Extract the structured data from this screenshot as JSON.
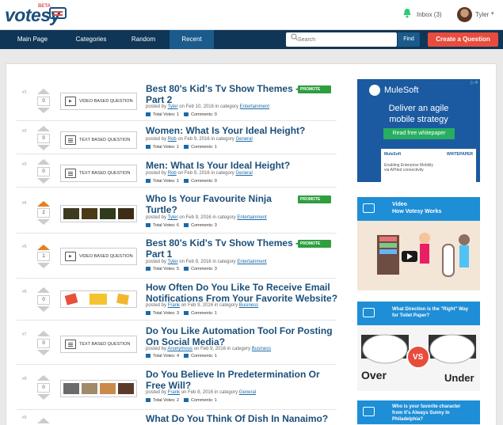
{
  "brand": {
    "name": "votesy",
    "badge": "BETA"
  },
  "header": {
    "inbox_label": "Inbox (3)",
    "user_name": "Tyler"
  },
  "nav": {
    "items": [
      {
        "label": "Main Page"
      },
      {
        "label": "Categories"
      },
      {
        "label": "Random"
      },
      {
        "label": "Recent",
        "active": true
      }
    ],
    "search_placeholder": "Search",
    "find_label": "Find",
    "create_label": "Create a Question"
  },
  "questions": [
    {
      "num": "#1",
      "votes": "0",
      "thumb_type": "video",
      "thumb_label": "VIDEO BASED QUESTION",
      "title_l1": "Best 80's Kid's Tv Show Themes -",
      "title_l2": "Part 2",
      "promote": "PROMOTE",
      "posted_by": "posted by",
      "author": "Tyler",
      "date_text": "on Feb 10, 2016 in category",
      "category": "Entertainment",
      "total_votes": "Total Votes: 1",
      "comments": "Comments: 0"
    },
    {
      "num": "#2",
      "votes": "0",
      "thumb_type": "text",
      "thumb_label": "TEXT BASED QUESTION",
      "title_l1": "Women: What Is Your Ideal Height?",
      "posted_by": "posted by",
      "author": "Rob",
      "date_text": "on Feb 9, 2016 in category",
      "category": "General",
      "total_votes": "Total Votes: 1",
      "comments": "Comments: 1"
    },
    {
      "num": "#3",
      "votes": "0",
      "thumb_type": "text",
      "thumb_label": "TEXT BASED QUESTION",
      "title_l1": "Men: What Is Your Ideal Height?",
      "posted_by": "posted by",
      "author": "Rob",
      "date_text": "on Feb 9, 2016 in category",
      "category": "General",
      "total_votes": "Total Votes: 1",
      "comments": "Comments: 0"
    },
    {
      "num": "#4",
      "votes": "2",
      "thumb_type": "images",
      "title_l1": "Who Is Your Favourite Ninja",
      "title_l2": "Turtle?",
      "promote": "PROMOTE",
      "posted_by": "posted by",
      "author": "Tyler",
      "date_text": "on Feb 9, 2016 in category",
      "category": "Entertainment",
      "total_votes": "Total Votes: 6",
      "comments": "Comments: 3",
      "voted": true
    },
    {
      "num": "#5",
      "votes": "1",
      "thumb_type": "video",
      "thumb_label": "VIDEO BASED QUESTION",
      "title_l1": "Best 80's Kid's Tv Show Themes -",
      "title_l2": "Part 1",
      "promote": "PROMOTE",
      "posted_by": "posted by",
      "author": "Tyler",
      "date_text": "on Feb 9, 2016 in category",
      "category": "Entertainment",
      "total_votes": "Total Votes: 5",
      "comments": "Comments: 3",
      "voted": true
    },
    {
      "num": "#6",
      "votes": "0",
      "thumb_type": "images2",
      "title_l1": "How Often Do You Like To Receive Email",
      "title_l2": "Notifications From Your Favorite Website?",
      "posted_by": "posted by",
      "author": "Frank",
      "date_text": "on Feb 9, 2016 in category",
      "category": "Business",
      "total_votes": "Total Votes: 3",
      "comments": "Comments: 1"
    },
    {
      "num": "#7",
      "votes": "0",
      "thumb_type": "text",
      "thumb_label": "TEXT BASED QUESTION",
      "title_l1": "Do You Like Automation Tool For Posting",
      "title_l2": "On Social Media?",
      "posted_by": "posted by",
      "author": "Anonymous",
      "date_text": "on Feb 9, 2016 in category",
      "category": "Business",
      "total_votes": "Total Votes: 4",
      "comments": "Comments: 1"
    },
    {
      "num": "#8",
      "votes": "0",
      "thumb_type": "images3",
      "title_l1": "Do You Believe In Predetermination Or",
      "title_l2": "Free Will?",
      "posted_by": "posted by",
      "author": "Frank",
      "date_text": "on Feb 8, 2016 in category",
      "category": "General",
      "total_votes": "Total Votes: 2",
      "comments": "Comments: 1"
    },
    {
      "num": "#9",
      "title_l1": "What Do You Think Of Dish In Nanaimo?"
    }
  ],
  "sidebar": {
    "ad": {
      "brand": "MuleSoft",
      "headline_l1": "Deliver an agile",
      "headline_l2": "mobile strategy",
      "cta": "Read free whitepaper",
      "paper_brand": "MuleSoft",
      "paper_tag": "WHITEPAPER",
      "paper_l1": "Enabling Enterprise Mobility",
      "paper_l2": "via APIled connectivity"
    },
    "video_card": {
      "label": "Video",
      "title": "How Votesy Works"
    },
    "toilet_card": {
      "title_l1": "What Direction is the \"Right\" Way",
      "title_l2": "for Toilet Paper?",
      "left_label": "Over",
      "right_label": "Under",
      "vs": "VS"
    },
    "sunny_card": {
      "title_l1": "Who is your favorite character",
      "title_l2": "from It's Always Sunny In",
      "title_l3": "Philadelphia?"
    }
  },
  "colors": {
    "accent": "#1b4f7a",
    "nav": "#0f3657",
    "promote": "#2e9e3e",
    "create": "#e74c3c",
    "vote": "#e67e22"
  }
}
